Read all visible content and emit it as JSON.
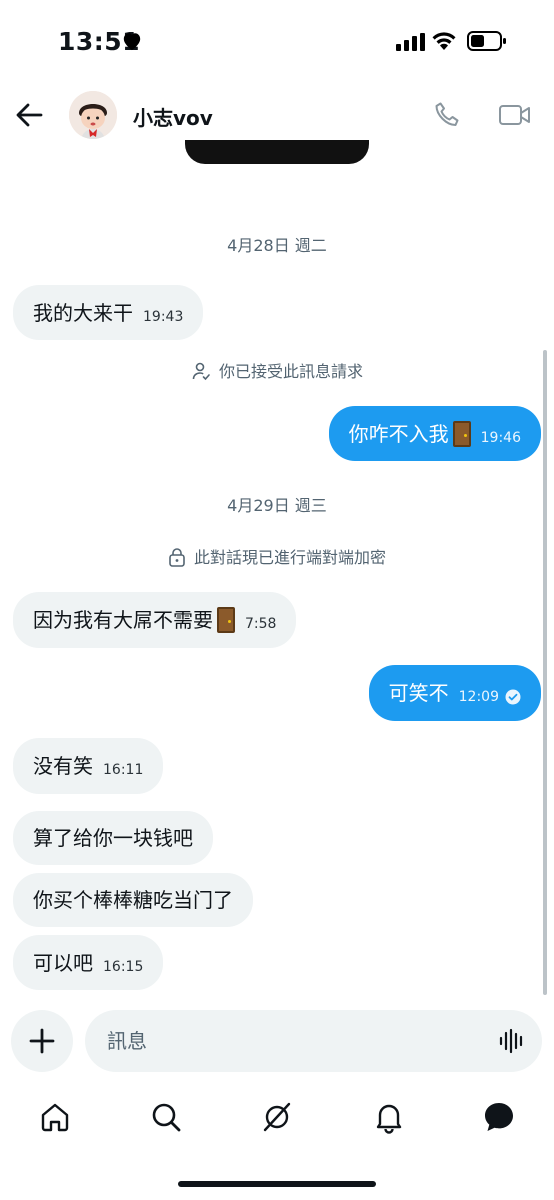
{
  "status_bar": {
    "time": "13:51"
  },
  "header": {
    "contact_name": "小志vov"
  },
  "messages": [
    {
      "kind": "date",
      "text": "4月28日 週二"
    },
    {
      "kind": "in",
      "text": "我的大来干",
      "time": "19:43"
    },
    {
      "kind": "system",
      "icon": "person-check-icon",
      "text": "你已接受此訊息請求"
    },
    {
      "kind": "out",
      "text": "你咋不入我",
      "emoji": "door",
      "time": "19:46"
    },
    {
      "kind": "date",
      "text": "4月29日 週三"
    },
    {
      "kind": "system",
      "icon": "lock-icon",
      "text": "此對話現已進行端對端加密"
    },
    {
      "kind": "in",
      "text": "因为我有大屌不需要",
      "emoji": "door",
      "time": "7:58"
    },
    {
      "kind": "out",
      "text": "可笑不",
      "time": "12:09",
      "status": "read"
    },
    {
      "kind": "in",
      "text": "没有笑",
      "time": "16:11"
    },
    {
      "kind": "in",
      "text": "算了给你一块钱吧",
      "time": ""
    },
    {
      "kind": "in",
      "text": "你买个棒棒糖吃当门了",
      "time": ""
    },
    {
      "kind": "in",
      "text": "可以吧",
      "time": "16:15"
    }
  ],
  "composer": {
    "placeholder": "訊息"
  },
  "nav": {
    "items": [
      "home-icon",
      "search-icon",
      "grok-icon",
      "notifications-icon",
      "messages-icon"
    ]
  },
  "colors": {
    "accent": "#1d9bf0",
    "incoming_bubble": "#eff3f4",
    "muted_text": "#536471"
  }
}
